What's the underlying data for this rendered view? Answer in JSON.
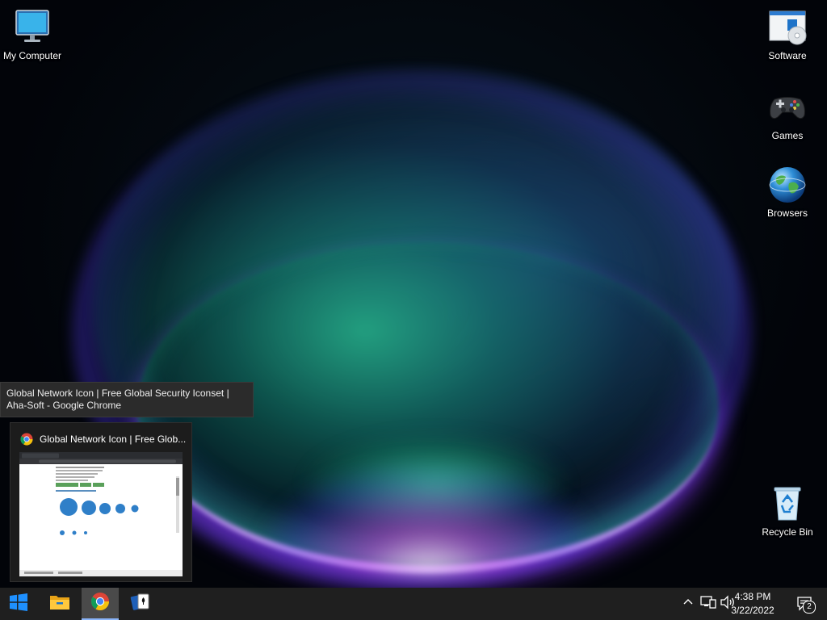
{
  "desktop": {
    "icons": [
      {
        "label": "My Computer",
        "icon": "monitor-icon"
      },
      {
        "label": "Software",
        "icon": "software-installer-icon"
      },
      {
        "label": "Games",
        "icon": "gamepad-icon"
      },
      {
        "label": "Browsers",
        "icon": "globe-icon"
      },
      {
        "label": "Recycle Bin",
        "icon": "recycle-bin-icon"
      }
    ]
  },
  "taskbar_preview": {
    "tooltip": "Global Network Icon | Free Global Security Iconset | Aha-Soft - Google Chrome",
    "window_title": "Global Network Icon | Free Glob...",
    "app_icon": "chrome-icon"
  },
  "taskbar": {
    "start_icon": "windows-logo-icon",
    "pinned": [
      {
        "name": "file-explorer",
        "icon": "folder-icon"
      },
      {
        "name": "google-chrome",
        "icon": "chrome-icon",
        "active": true
      },
      {
        "name": "solitaire",
        "icon": "cards-icon"
      }
    ]
  },
  "tray": {
    "show_hidden_icon": "chevron-up-icon",
    "network_icon": "network-icon",
    "volume_icon": "speaker-icon",
    "time": "4:38 PM",
    "date": "3/22/2022",
    "notification_count": "2"
  },
  "colors": {
    "taskbar_bg": "#1f1f1f",
    "accent": "#8ab4f8",
    "tooltip_bg": "#2b2b2b"
  }
}
